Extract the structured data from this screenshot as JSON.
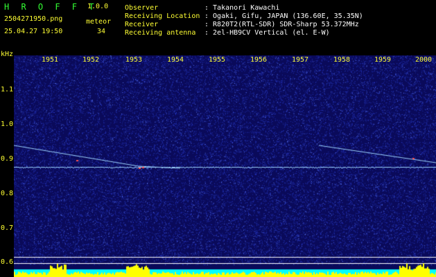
{
  "header": {
    "app_name": "H R O F F T",
    "version": "1.0.0",
    "filename": "2504271950.png",
    "timestamp": "25.04.27 19:50",
    "meteor_label": "meteor",
    "meteor_count": "34",
    "info_labels": [
      "Observer",
      "Receiving Location",
      "Receiver",
      "Receiving antenna"
    ],
    "info_values": [
      ": Takanori Kawachi",
      ": Ogaki, Gifu, JAPAN (136.60E, 35.35N)",
      ": R820T2(RTL-SDR) SDR-Sharp 53.372MHz",
      ": 2el-HB9CV Vertical (el. E-W)"
    ]
  },
  "spectrogram": {
    "unit_label": "kHz",
    "time_ticks": [
      "1951",
      "1952",
      "1953",
      "1954",
      "1955",
      "1956",
      "1957",
      "1958",
      "1959",
      "2000"
    ],
    "freq_ticks": [
      "1.1",
      "1.0",
      "0.9",
      "0.8",
      "0.7",
      "0.6"
    ],
    "colors": {
      "background": "#0a0a5a",
      "noise": "#2a3acc",
      "trace": "#9fd6ff",
      "hot": "#ff5050",
      "meter": "#ffff00",
      "meter_base": "#00ffff",
      "label": "#ffff33"
    }
  }
}
